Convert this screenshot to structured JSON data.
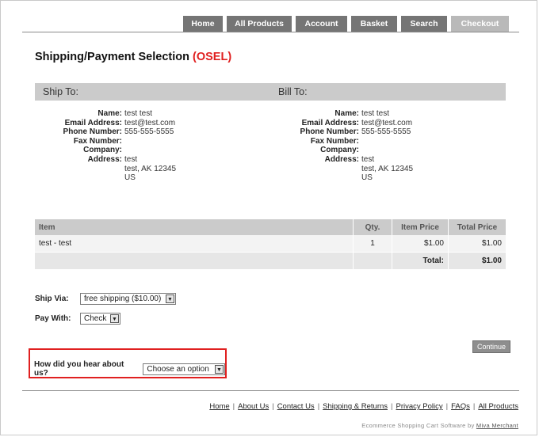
{
  "nav": {
    "tabs": [
      {
        "label": "Home"
      },
      {
        "label": "All Products"
      },
      {
        "label": "Account"
      },
      {
        "label": "Basket"
      },
      {
        "label": "Search"
      },
      {
        "label": "Checkout"
      }
    ]
  },
  "page": {
    "title": "Shipping/Payment Selection",
    "code": "(OSEL)"
  },
  "ship_to": {
    "heading": "Ship To:",
    "labels": {
      "name": "Name:",
      "email": "Email Address:",
      "phone": "Phone Number:",
      "fax": "Fax Number:",
      "company": "Company:",
      "address": "Address:"
    },
    "name": "test test",
    "email": "test@test.com",
    "phone": "555-555-5555",
    "fax": "",
    "company": "",
    "address1": "test",
    "address2": "test, AK 12345",
    "country": "US"
  },
  "bill_to": {
    "heading": "Bill To:",
    "labels": {
      "name": "Name:",
      "email": "Email Address:",
      "phone": "Phone Number:",
      "fax": "Fax Number:",
      "company": "Company:",
      "address": "Address:"
    },
    "name": "test test",
    "email": "test@test.com",
    "phone": "555-555-5555",
    "fax": "",
    "company": "",
    "address1": "test",
    "address2": "test, AK 12345",
    "country": "US"
  },
  "items_table": {
    "headers": {
      "item": "Item",
      "qty": "Qty.",
      "price": "Item Price",
      "total": "Total Price"
    },
    "rows": [
      {
        "item": "test - test",
        "qty": "1",
        "price": "$1.00",
        "total": "$1.00"
      }
    ],
    "total_label": "Total:",
    "total_value": "$1.00"
  },
  "ship_via": {
    "label": "Ship Via:",
    "value": "free shipping ($10.00)"
  },
  "pay_with": {
    "label": "Pay With:",
    "value": "Check"
  },
  "continue_label": "Continue",
  "survey": {
    "label": "How did you hear about us?",
    "value": "Choose an option"
  },
  "footer": {
    "links": [
      "Home",
      "About Us",
      "Contact Us",
      "Shipping & Returns",
      "Privacy Policy",
      "FAQs",
      "All Products"
    ],
    "credit_prefix": "Ecommerce Shopping Cart Software by",
    "credit_link": "Miva Merchant"
  }
}
